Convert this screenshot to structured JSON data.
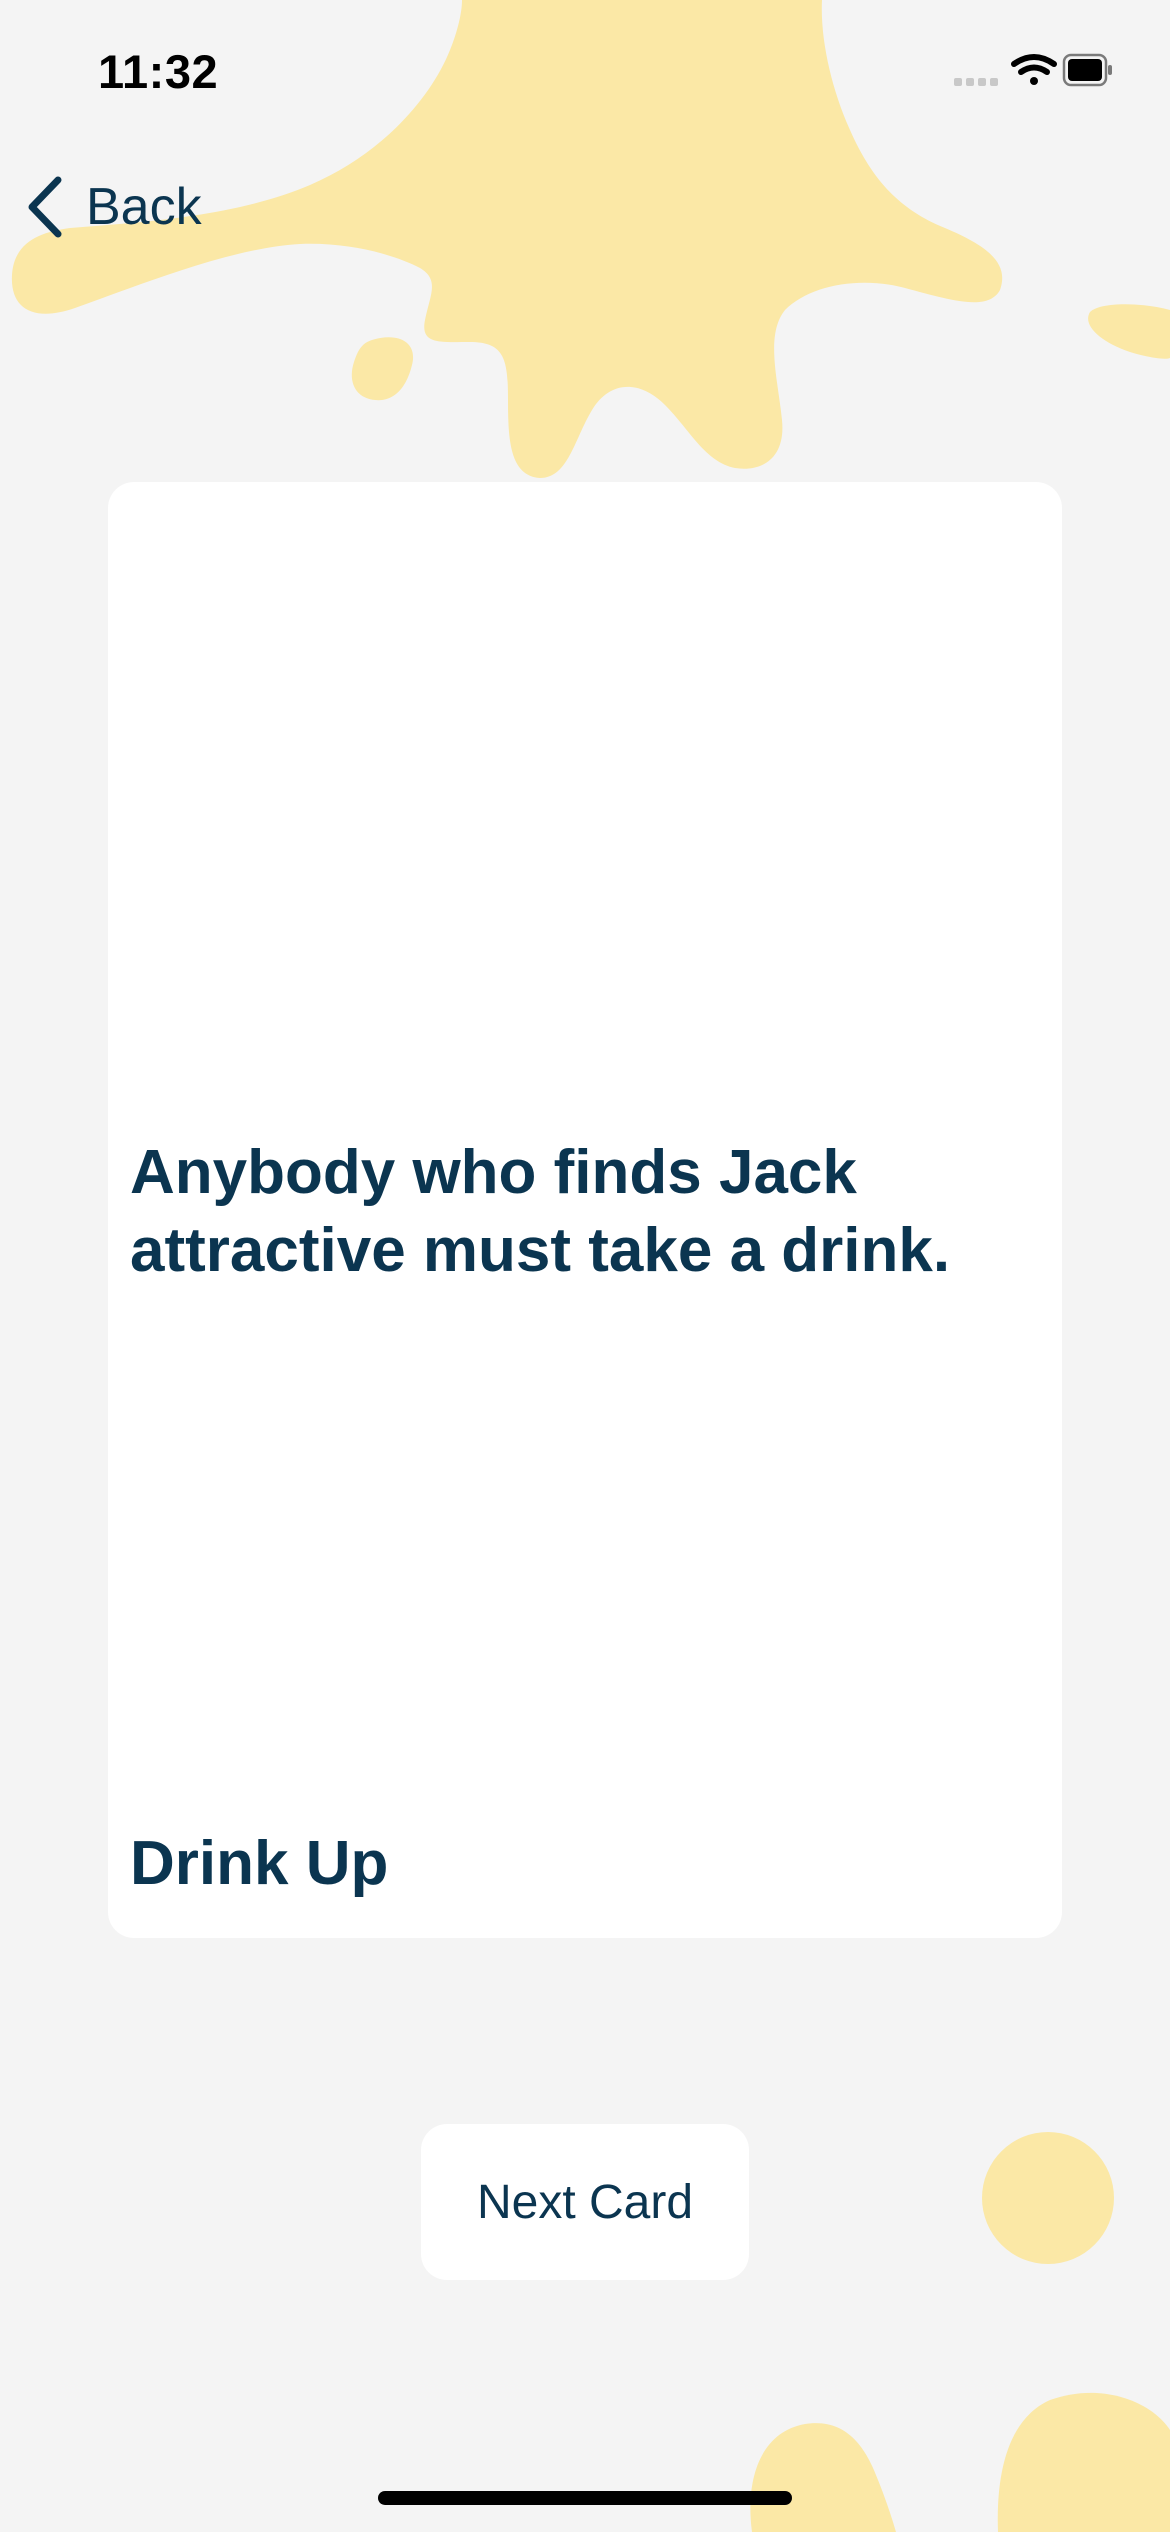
{
  "status_bar": {
    "time": "11:32",
    "icons": [
      "cellular-signal-icon",
      "wifi-icon",
      "battery-icon"
    ]
  },
  "nav": {
    "back_label": "Back",
    "back_icon": "chevron-left-icon"
  },
  "card": {
    "prompt": "Anybody who finds Jack attractive must take a drink.",
    "category": "Drink Up"
  },
  "actions": {
    "next_label": "Next Card"
  },
  "colors": {
    "background": "#f4f4f4",
    "accent_splash": "#fbe8a6",
    "text": "#0b3550",
    "card": "#ffffff"
  }
}
